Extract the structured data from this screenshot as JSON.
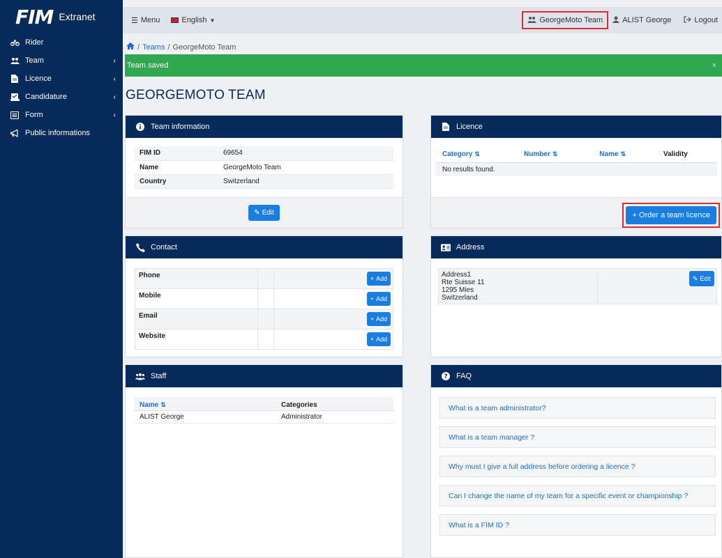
{
  "sidebar": {
    "logo": "FIM",
    "logo_text": "Extranet",
    "items": [
      {
        "label": "Rider",
        "icon": "bicycle-icon"
      },
      {
        "label": "Team",
        "icon": "users-icon"
      },
      {
        "label": "Licence",
        "icon": "file-icon"
      },
      {
        "label": "Candidature",
        "icon": "candidature-icon"
      },
      {
        "label": "Form",
        "icon": "list-icon"
      },
      {
        "label": "Public informations",
        "icon": "bullhorn-icon"
      }
    ]
  },
  "topbar": {
    "menu_label": "Menu",
    "language_label": "English",
    "team_label": "GeorgeMoto Team",
    "user_label": "ALIST George",
    "logout_label": "Logout"
  },
  "breadcrumb": {
    "teams": "Teams",
    "current": "GeorgeMoto Team"
  },
  "alert": {
    "message": "Team saved",
    "close": "×"
  },
  "page_title": "GEORGEMOTO TEAM",
  "team_info": {
    "title": "Team information",
    "rows": [
      {
        "key": "FIM ID",
        "value": "69654"
      },
      {
        "key": "Name",
        "value": "GeorgeMoto Team"
      },
      {
        "key": "Country",
        "value": "Switzerland"
      }
    ],
    "edit_label": "Edit"
  },
  "licence": {
    "title": "Licence",
    "columns": [
      "Category",
      "Number",
      "Name",
      "Validity"
    ],
    "empty": "No results found.",
    "order_label": "Order a team licence"
  },
  "contact": {
    "title": "Contact",
    "rows": [
      "Phone",
      "Mobile",
      "Email",
      "Website"
    ],
    "add_label": "Add"
  },
  "address": {
    "title": "Address",
    "lines": [
      "Address1",
      "Rte Suisse 11",
      "1295 Mies",
      "Switzerland"
    ],
    "edit_label": "Edit"
  },
  "staff": {
    "title": "Staff",
    "columns": [
      "Name",
      "Categories"
    ],
    "rows": [
      {
        "name": "ALIST George",
        "category": "Administrator"
      }
    ]
  },
  "faq": {
    "title": "FAQ",
    "items": [
      "What is a team administrator?",
      "What is a team manager ?",
      "Why must I give a full address before ordering a licence ?",
      "Can I change the name of my team for a specific event or championship ?",
      "What is a FIM ID ?"
    ]
  },
  "colors": {
    "navy": "#062a5a",
    "accent_blue": "#1a7de0",
    "success_green": "#2fa84f",
    "highlight_red": "#e02b2b"
  }
}
